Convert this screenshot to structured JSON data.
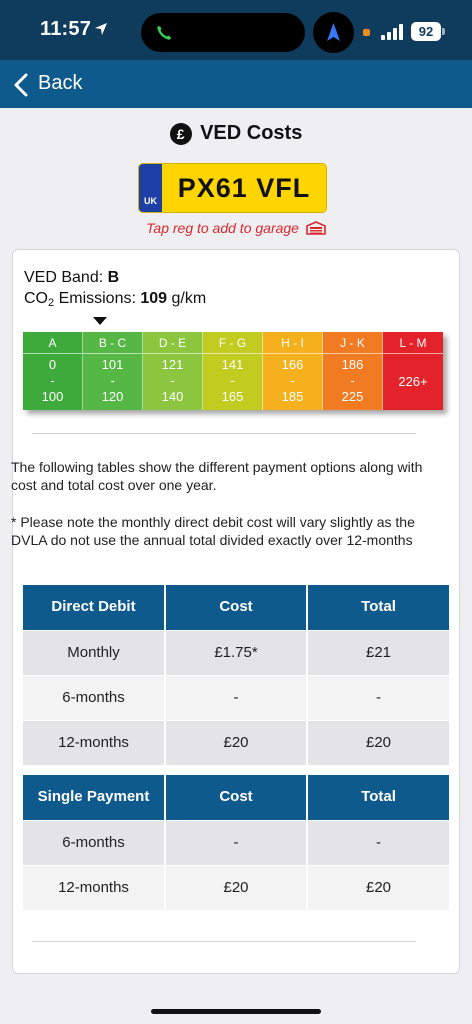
{
  "status_bar": {
    "time": "11:57",
    "battery": "92"
  },
  "nav": {
    "back_label": "Back"
  },
  "page": {
    "title": "VED Costs"
  },
  "plate": {
    "country": "UK",
    "registration": "PX61 VFL",
    "tap_hint": "Tap reg to add to garage"
  },
  "vehicle": {
    "band_label": "VED Band: ",
    "band_value": "B",
    "co2_label_pre": "CO",
    "co2_sub": "2",
    "co2_label_post": " Emissions: ",
    "co2_value": "109",
    "co2_unit": " g/km"
  },
  "bands": [
    {
      "label": "A",
      "from": "0",
      "dash": "-",
      "to": "100",
      "color": "#3faa3c"
    },
    {
      "label": "B - C",
      "from": "101",
      "dash": "-",
      "to": "120",
      "color": "#55b844"
    },
    {
      "label": "D - E",
      "from": "121",
      "dash": "-",
      "to": "140",
      "color": "#8cc63f"
    },
    {
      "label": "F - G",
      "from": "141",
      "dash": "-",
      "to": "165",
      "color": "#c2cb1f"
    },
    {
      "label": "H - I",
      "from": "166",
      "dash": "-",
      "to": "185",
      "color": "#f4b11d"
    },
    {
      "label": "J - K",
      "from": "186",
      "dash": "-",
      "to": "225",
      "color": "#f07b22"
    },
    {
      "label": "L - M",
      "single": "226+",
      "color": "#e3222a"
    }
  ],
  "text": {
    "intro": "The following tables show the different payment options along with cost and total cost over one year.",
    "note": "* Please note the monthly direct debit cost will vary slightly as the DVLA do not use the annual total divided exactly over 12-months"
  },
  "direct_debit": {
    "headers": [
      "Direct Debit",
      "Cost",
      "Total"
    ],
    "rows": [
      [
        "Monthly",
        "£1.75*",
        "£21"
      ],
      [
        "6-months",
        "-",
        "-"
      ],
      [
        "12-months",
        "£20",
        "£20"
      ]
    ]
  },
  "single_payment": {
    "headers": [
      "Single Payment",
      "Cost",
      "Total"
    ],
    "rows": [
      [
        "6-months",
        "-",
        "-"
      ],
      [
        "12-months",
        "£20",
        "£20"
      ]
    ]
  }
}
